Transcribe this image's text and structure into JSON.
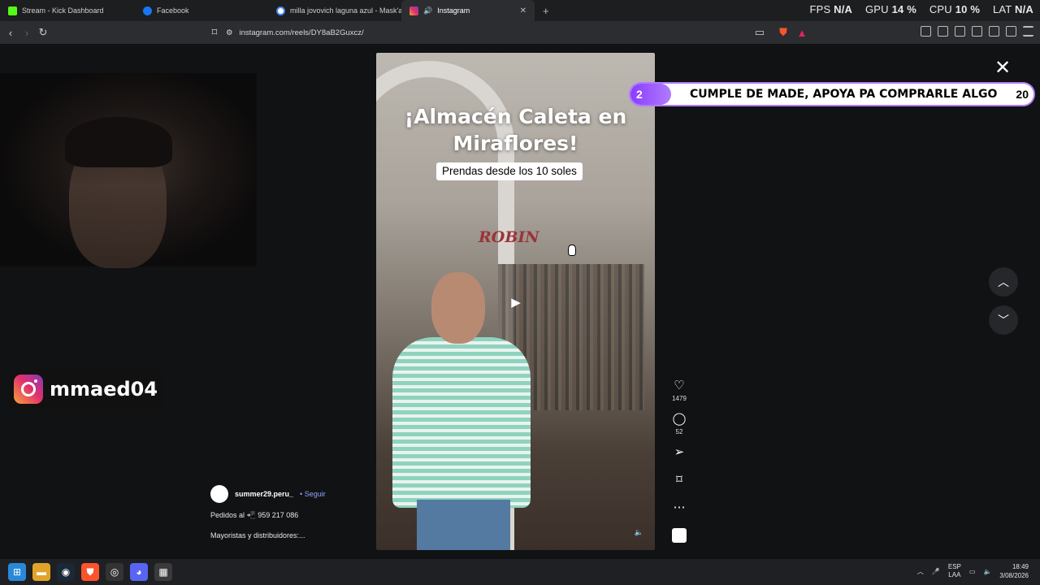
{
  "browser": {
    "tabs": [
      {
        "label": "Stream - Kick Dashboard",
        "color": "#53fc18"
      },
      {
        "label": "Facebook",
        "color": "#1877f2"
      },
      {
        "label": "milla jovovich laguna azul - Mask'ana",
        "color": "#4285f4"
      },
      {
        "label": "Instagram",
        "color": "#e1306c",
        "active": true
      }
    ],
    "url": "instagram.com/reels/DY8aB2Guxcz/",
    "stats": {
      "fps_label": "FPS",
      "fps_value": "N/A",
      "gpu_label": "GPU",
      "gpu_value": "14 %",
      "cpu_label": "CPU",
      "cpu_value": "10 %",
      "lat_label": "LAT",
      "lat_value": "N/A"
    }
  },
  "overlay": {
    "instagram_handle": "mmaed04",
    "banner": {
      "left_num": "2",
      "text": "CUMPLE DE MADE, APOYA PA COMPRARLE ALGO",
      "right_num": "20"
    }
  },
  "reel": {
    "title_line1": "¡Almacén Caleta en",
    "title_line2": "Miraflores!",
    "subtitle": "Prendas desde los 10 soles",
    "brand_sign": "ROBIN",
    "likes": "1479",
    "comments": "52",
    "caption": {
      "username": "summer29.peru_",
      "follow": "• Seguir",
      "line1": "Pedidos al 📲 959 217 086",
      "line2": "Mayoristas y distribuidores:..."
    }
  },
  "taskbar": {
    "lang_line1": "ESP",
    "lang_line2": "LAA",
    "time": "18:49",
    "date": "3/08/2026"
  }
}
